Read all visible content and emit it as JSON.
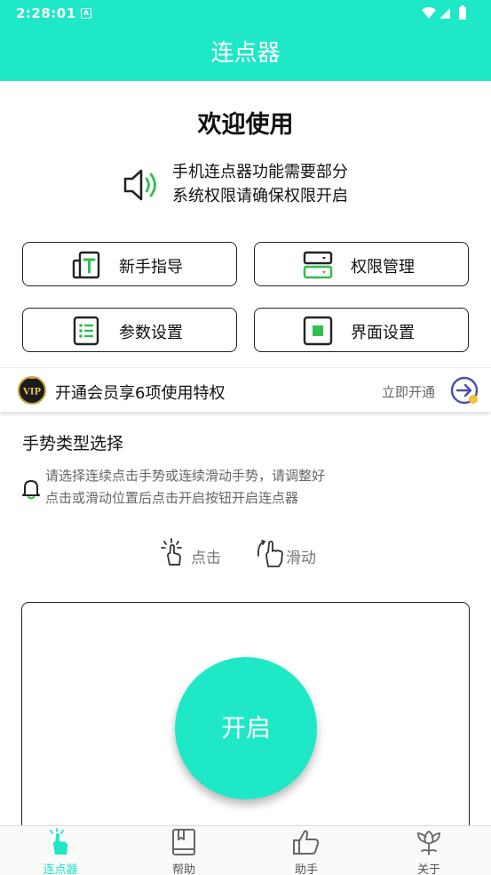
{
  "status_bar": {
    "time": "2:28:01",
    "notification": "A"
  },
  "app_bar": {
    "title": "连点器"
  },
  "welcome": {
    "title": "欢迎使用",
    "notice_line1": "手机连点器功能需要部分",
    "notice_line2": "系统权限请确保权限开启"
  },
  "menu": [
    {
      "label": "新手指导",
      "icon": "tutorial-icon"
    },
    {
      "label": "权限管理",
      "icon": "permission-icon"
    },
    {
      "label": "参数设置",
      "icon": "list-settings-icon"
    },
    {
      "label": "界面设置",
      "icon": "interface-icon"
    }
  ],
  "vip": {
    "badge": "VIP",
    "text": "开通会员享6项使用特权",
    "action": "立即开通"
  },
  "gesture_section": {
    "title": "手势类型选择",
    "hint_line1": "请选择连续点击手势或连续滑动手势，请调整好",
    "hint_line2": "点击或滑动位置后点击开启按钮开启连点器",
    "options": [
      {
        "label": "点击",
        "icon": "tap-gesture-icon"
      },
      {
        "label": "滑动",
        "icon": "swipe-gesture-icon"
      }
    ]
  },
  "start_button": {
    "label": "开启"
  },
  "bottom_nav": [
    {
      "label": "连点器",
      "icon": "tap-icon",
      "active": true
    },
    {
      "label": "帮助",
      "icon": "book-icon",
      "active": false
    },
    {
      "label": "助手",
      "icon": "thumbs-up-icon",
      "active": false
    },
    {
      "label": "关于",
      "icon": "flower-icon",
      "active": false
    }
  ],
  "colors": {
    "accent": "#1ee8c6",
    "icon_green": "#2fbf4f",
    "vip_arrow": "#4d4db0"
  }
}
